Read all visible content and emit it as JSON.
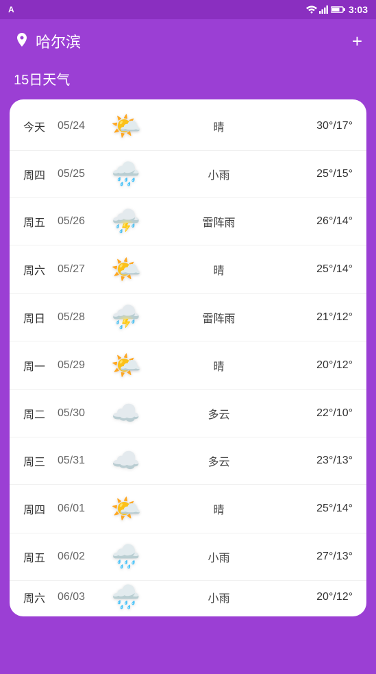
{
  "statusBar": {
    "appLabel": "A",
    "time": "3:03"
  },
  "header": {
    "city": "哈尔滨",
    "addLabel": "+"
  },
  "sectionTitle": "15日天气",
  "weatherRows": [
    {
      "day": "今天",
      "date": "05/24",
      "icon": "sunny",
      "desc": "晴",
      "temp": "30°/17°"
    },
    {
      "day": "周四",
      "date": "05/25",
      "icon": "rainy",
      "desc": "小雨",
      "temp": "25°/15°"
    },
    {
      "day": "周五",
      "date": "05/26",
      "icon": "thunder",
      "desc": "雷阵雨",
      "temp": "26°/14°"
    },
    {
      "day": "周六",
      "date": "05/27",
      "icon": "sunny",
      "desc": "晴",
      "temp": "25°/14°"
    },
    {
      "day": "周日",
      "date": "05/28",
      "icon": "thunder",
      "desc": "雷阵雨",
      "temp": "21°/12°"
    },
    {
      "day": "周一",
      "date": "05/29",
      "icon": "sunny",
      "desc": "晴",
      "temp": "20°/12°"
    },
    {
      "day": "周二",
      "date": "05/30",
      "icon": "cloudy",
      "desc": "多云",
      "temp": "22°/10°"
    },
    {
      "day": "周三",
      "date": "05/31",
      "icon": "cloudy",
      "desc": "多云",
      "temp": "23°/13°"
    },
    {
      "day": "周四",
      "date": "06/01",
      "icon": "sunny",
      "desc": "晴",
      "temp": "25°/14°"
    },
    {
      "day": "周五",
      "date": "06/02",
      "icon": "rainy",
      "desc": "小雨",
      "temp": "27°/13°"
    },
    {
      "day": "周六",
      "date": "06/03",
      "icon": "rainy",
      "desc": "小雨",
      "temp": "20°/12°"
    }
  ],
  "icons": {
    "sunny": "🌤️",
    "rainy": "🌧️",
    "thunder": "⛈️",
    "cloudy": "☁️",
    "location": "📍"
  }
}
